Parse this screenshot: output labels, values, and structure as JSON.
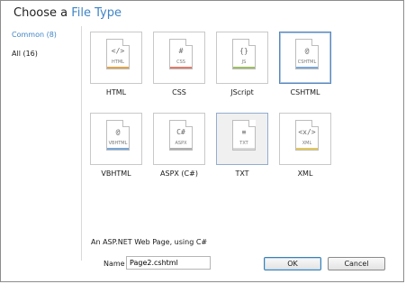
{
  "dialog": {
    "title_prefix": "Choose a ",
    "title_accent": "File Type"
  },
  "sidebar": {
    "items": [
      {
        "label": "Common (8)",
        "selected": true
      },
      {
        "label": "All (16)",
        "selected": false
      }
    ]
  },
  "file_types": [
    {
      "label": "HTML",
      "symbol": "</>",
      "ext": "HTML",
      "icon": "html-file-icon",
      "color": "#e2a44a"
    },
    {
      "label": "CSS",
      "symbol": "#",
      "ext": "CSS",
      "icon": "css-file-icon",
      "color": "#e07b6b"
    },
    {
      "label": "JScript",
      "symbol": "{}",
      "ext": "JS",
      "icon": "js-file-icon",
      "color": "#9fbf63"
    },
    {
      "label": "CSHTML",
      "symbol": "@",
      "ext": "CSHTML",
      "icon": "cshtml-file-icon",
      "color": "#7aa7d6"
    },
    {
      "label": "VBHTML",
      "symbol": "@",
      "ext": "VBHTML",
      "icon": "vbhtml-file-icon",
      "color": "#7aa7d6"
    },
    {
      "label": "ASPX (C#)",
      "symbol": "C#",
      "ext": "ASPX",
      "icon": "aspx-file-icon",
      "color": "#b0b0b0"
    },
    {
      "label": "TXT",
      "symbol": "≡",
      "ext": "TXT",
      "icon": "txt-file-icon",
      "color": "#d8d8d8"
    },
    {
      "label": "XML",
      "symbol": "<x/>",
      "ext": "XML",
      "icon": "xml-file-icon",
      "color": "#e2c85a"
    }
  ],
  "description": "An ASP.NET Web Page, using C#",
  "name_field": {
    "label": "Name",
    "value": "Page2.cshtml"
  },
  "buttons": {
    "ok": "OK",
    "cancel": "Cancel"
  }
}
